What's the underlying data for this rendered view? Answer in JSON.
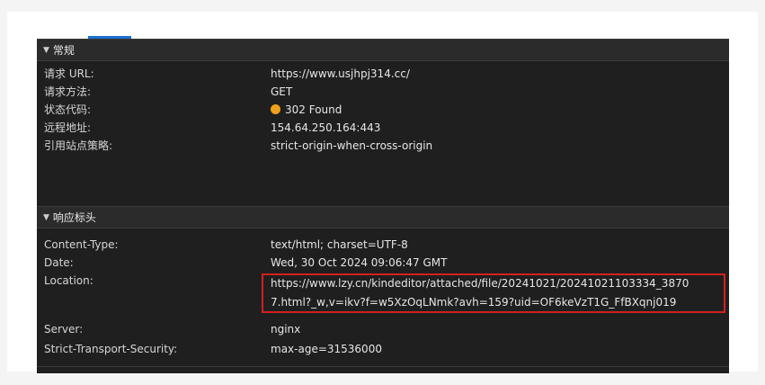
{
  "general": {
    "title": "常规",
    "rows": [
      {
        "key": "请求 URL:",
        "value": "https://www.usjhpj314.cc/"
      },
      {
        "key": "请求方法:",
        "value": "GET"
      },
      {
        "key": "状态代码:",
        "value": "302 Found",
        "status_color": "#f0a01c"
      },
      {
        "key": "远程地址:",
        "value": "154.64.250.164:443"
      },
      {
        "key": "引用站点策略:",
        "value": "strict-origin-when-cross-origin"
      }
    ]
  },
  "response_headers": {
    "title": "响应标头",
    "rows": [
      {
        "key": "Content-Type:",
        "value": "text/html; charset=UTF-8"
      },
      {
        "key": "Date:",
        "value": "Wed, 30 Oct 2024 09:06:47 GMT"
      },
      {
        "key": "Location:",
        "value_line1": "https://www.lzy.cn/kindeditor/attached/file/20241021/20241021103334_3870",
        "value_line2": "7.html?_w,v=ikv?f=w5XzOqLNmk?avh=159?uid=OF6keVzT1G_FfBXqnj019"
      },
      {
        "key": "Server:",
        "value": "nginx"
      },
      {
        "key": "Strict-Transport-Security:",
        "value": "max-age=31536000"
      }
    ]
  },
  "icons": {
    "collapse_triangle": "triangle-down-icon",
    "status": "status-dot-icon"
  },
  "colors": {
    "panel_bg": "#1f1f1f",
    "highlight_border": "#d42020",
    "status_warning": "#f0a01c",
    "tab_accent": "#1a6fd1"
  }
}
